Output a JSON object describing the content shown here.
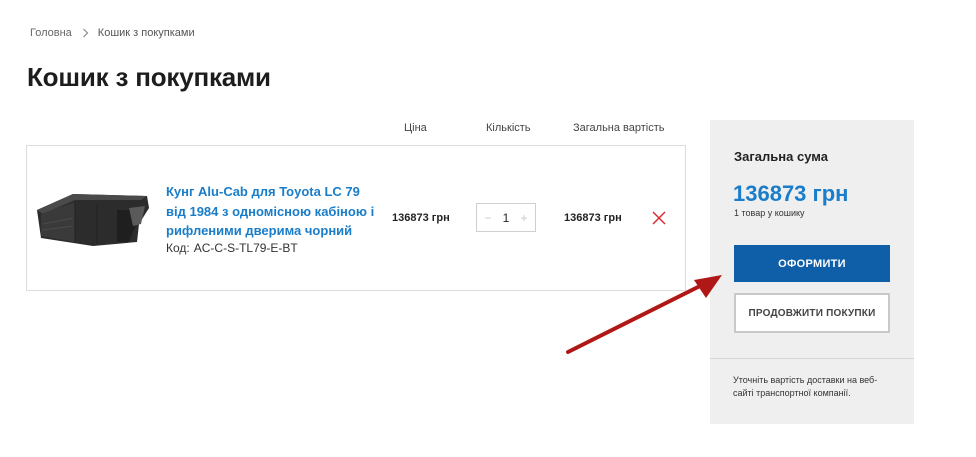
{
  "breadcrumb": {
    "home": "Головна",
    "current": "Кошик з покупками"
  },
  "page": {
    "title": "Кошик з покупками"
  },
  "table": {
    "headers": {
      "price": "Ціна",
      "quantity": "Кількість",
      "total": "Загальна вартість"
    }
  },
  "cart": {
    "items": [
      {
        "name": "Кунг Alu-Cab для Toyota LC 79 від 1984 з одномісною кабіною і рифленими дверима чорний",
        "code_label": "Код:",
        "code": "AC-C-S-TL79-E-BT",
        "price": "136873 грн",
        "quantity": "1",
        "minus": "−",
        "plus": "+",
        "total": "136873 грн"
      }
    ]
  },
  "summary": {
    "title": "Загальна сума",
    "amount": "136873 грн",
    "count": "1 товар у кошику",
    "checkout_label": "ОФОРМИТИ",
    "continue_label": "ПРОДОВЖИТИ ПОКУПКИ",
    "note": "Уточніть вартість доставки на веб-сайті транспортної компанії."
  },
  "colors": {
    "link": "#1a7dc9",
    "checkout_bg": "#0e5fa8",
    "remove_icon": "#d9262c",
    "annotation_arrow": "#b01717"
  },
  "icons": {
    "breadcrumb_separator": "chevron-right-icon",
    "remove": "close-icon"
  }
}
